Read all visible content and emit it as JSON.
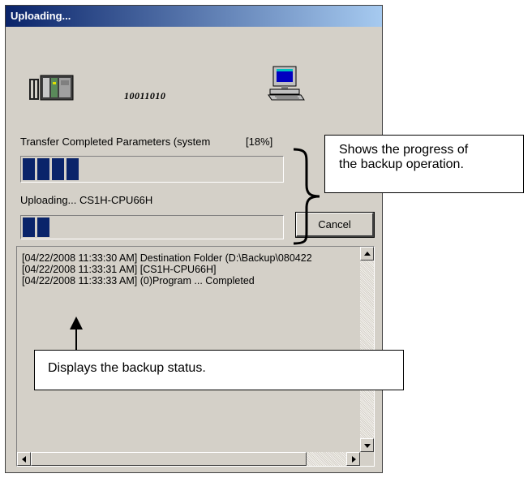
{
  "window": {
    "title": "Uploading..."
  },
  "transfer": {
    "binary_text": "10011010",
    "overall_label": "Transfer Completed Parameters (system",
    "overall_percent": "[18%]",
    "overall_blocks": 4,
    "current_label": "Uploading... CS1H-CPU66H",
    "current_blocks": 2
  },
  "buttons": {
    "cancel": "Cancel"
  },
  "log": {
    "lines": [
      "[04/22/2008 11:33:30 AM] Destination Folder (D:\\Backup\\080422",
      "[04/22/2008 11:33:31 AM] [CS1H-CPU66H]",
      "[04/22/2008 11:33:33 AM]   (0)Program   ... Completed"
    ]
  },
  "callouts": {
    "progress_line1": "Shows the progress of",
    "progress_line2": "the backup operation.",
    "status": "Displays the backup status."
  },
  "colors": {
    "title_start": "#0a246a",
    "title_end": "#a6caf0",
    "progress_block": "#0a246a",
    "dialog_bg": "#d4d0c8"
  },
  "icons": {
    "plc": "plc-icon",
    "computer": "computer-icon"
  }
}
